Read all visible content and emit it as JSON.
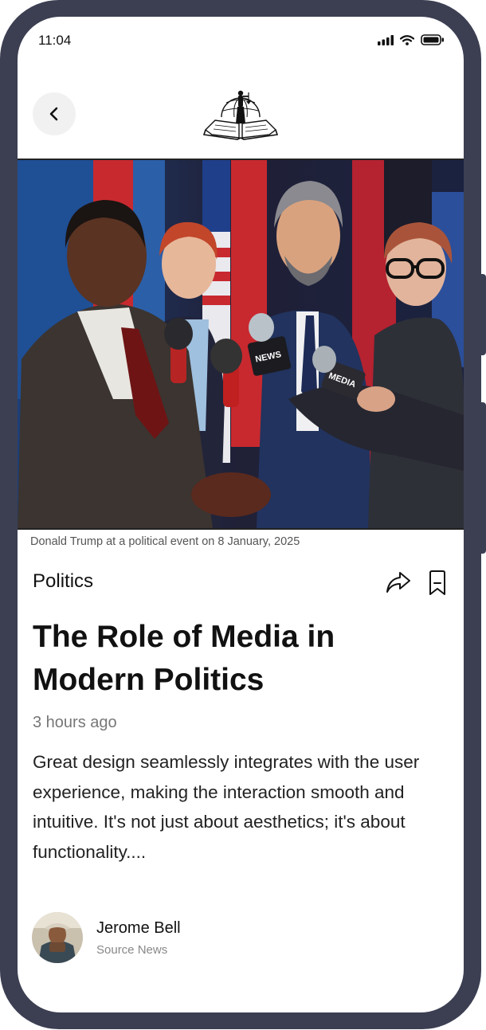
{
  "status_bar": {
    "time": "11:04"
  },
  "header": {
    "back_icon": "chevron-left-icon",
    "logo": "globe-book-statue-logo"
  },
  "hero": {
    "caption": "Donald Trump at a political event on 8 January, 2025",
    "mic_labels": [
      "NEWS",
      "MEDIA"
    ]
  },
  "article": {
    "category": "Politics",
    "title_line1": "The Role of Media in",
    "title_line2": "Modern Politics",
    "time_ago": "3 hours ago",
    "excerpt": "Great design seamlessly integrates with the user experience, making the interaction smooth and intuitive. It's not just about aesthetics; it's about functionality....",
    "actions": {
      "share_icon": "share-icon",
      "bookmark_icon": "bookmark-icon"
    }
  },
  "author": {
    "name": "Jerome Bell",
    "source": "Source News"
  },
  "colors": {
    "phone_frame": "#3c3f52",
    "text": "#111111",
    "muted": "#777777"
  }
}
